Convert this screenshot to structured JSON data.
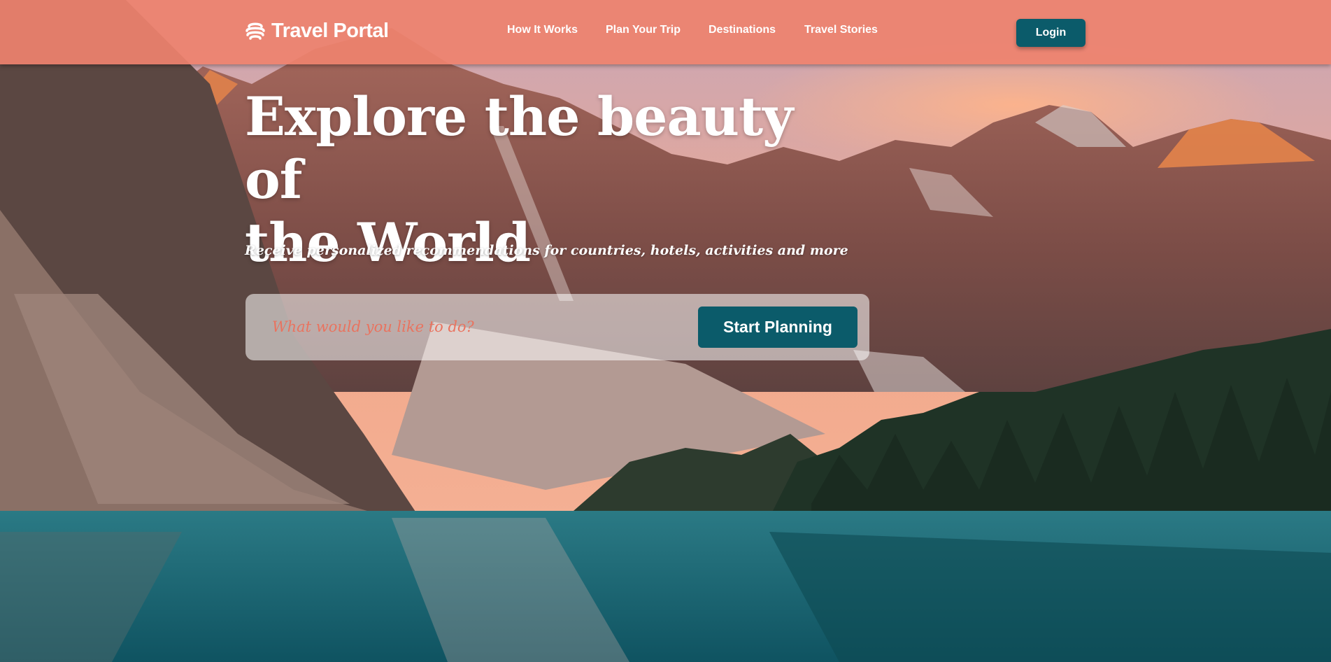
{
  "brand": {
    "name": "Travel Portal",
    "logo_icon": "globe-stack-icon"
  },
  "nav": {
    "items": [
      {
        "label": "How It Works"
      },
      {
        "label": "Plan Your Trip"
      },
      {
        "label": "Destinations"
      },
      {
        "label": "Travel Stories"
      }
    ],
    "login_label": "Login"
  },
  "hero": {
    "headline_line1": "Explore the beauty of",
    "headline_line2": "the World",
    "subline": "Receive personalized recommendations for countries, hotels, activities and more",
    "search_placeholder": "What would you like to do?",
    "search_value": "",
    "cta_label": "Start Planning"
  },
  "colors": {
    "topbar": "#EE826E",
    "primary_button": "#0B5B6A",
    "placeholder": "#E9735F",
    "text_light": "#FFFFFF"
  }
}
